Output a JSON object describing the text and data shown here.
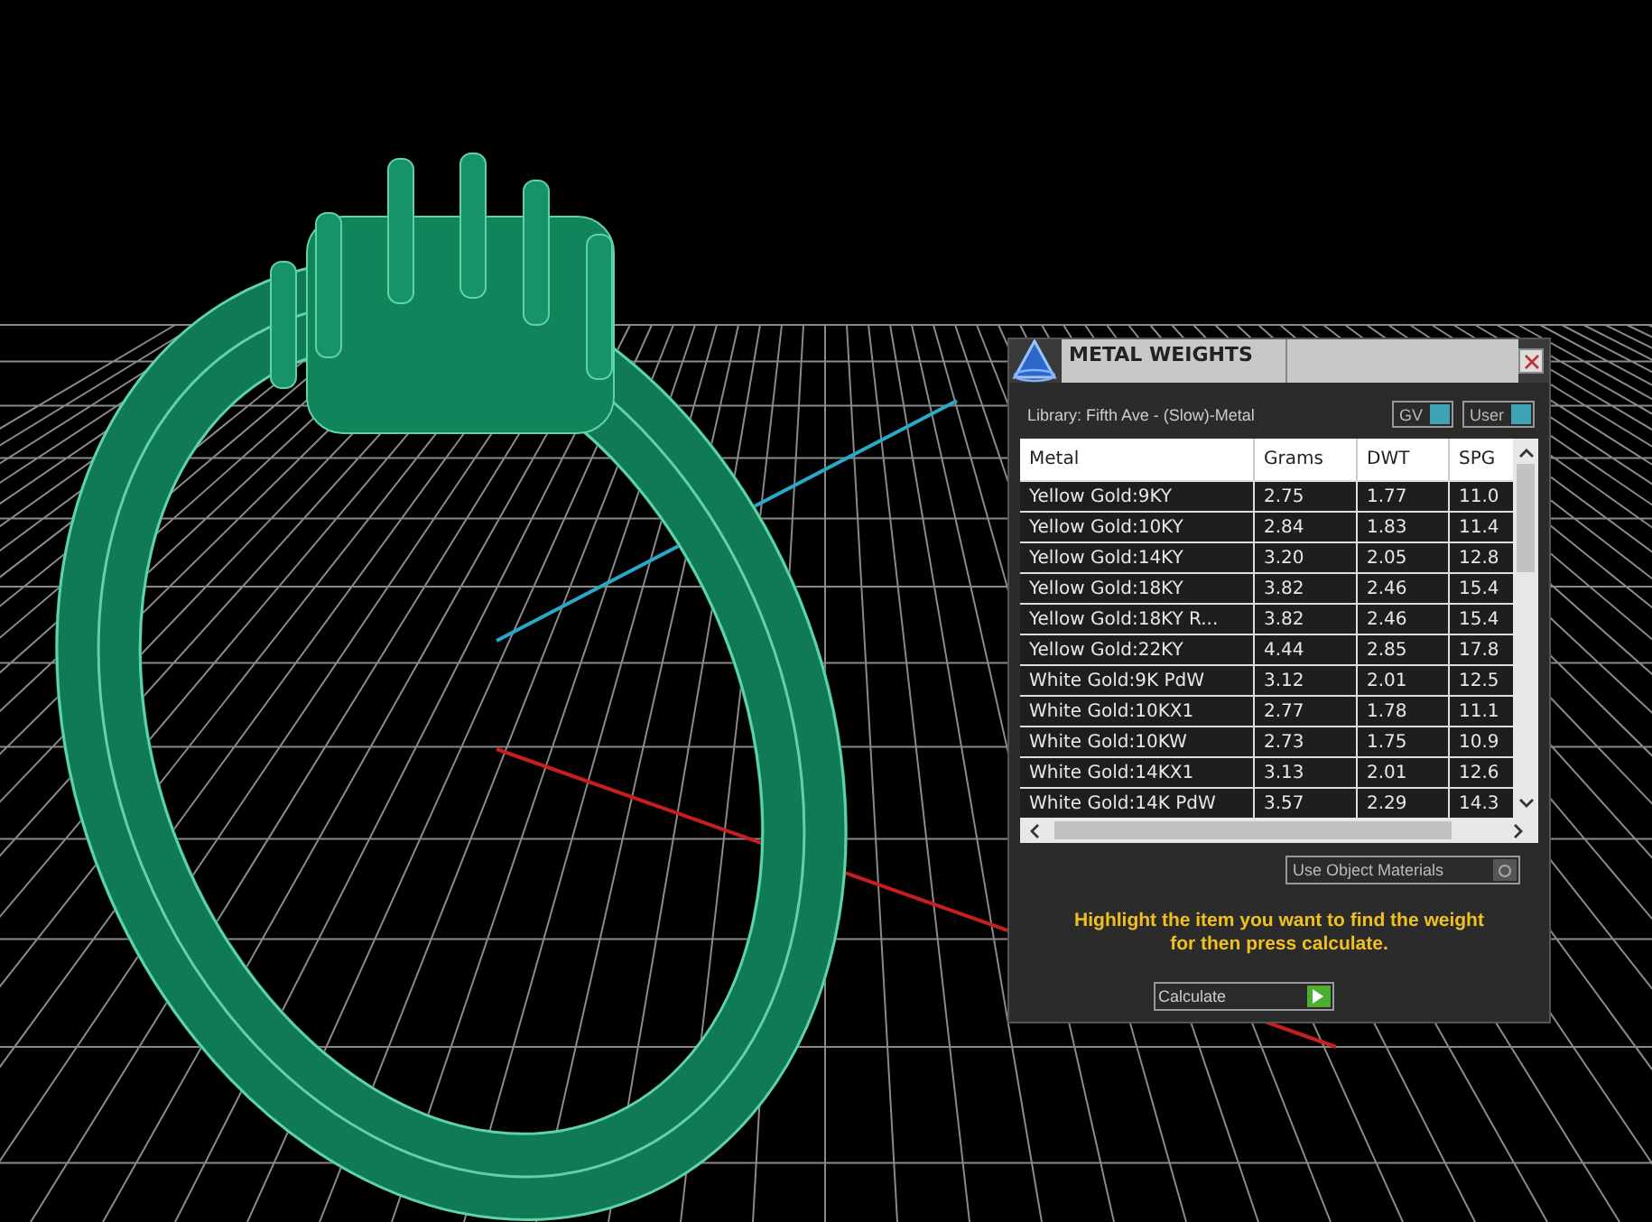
{
  "window": {
    "title": "METAL WEIGHTS"
  },
  "library": "Library: Fifth Ave - (Slow)-Metal",
  "toggles": [
    {
      "label": "GV",
      "on": true
    },
    {
      "label": "User",
      "on": true
    }
  ],
  "table": {
    "columns": [
      "Metal",
      "Grams",
      "DWT",
      "SPG"
    ],
    "rows": [
      [
        "Yellow Gold:9KY",
        "2.75",
        "1.77",
        "11.0"
      ],
      [
        "Yellow Gold:10KY",
        "2.84",
        "1.83",
        "11.4"
      ],
      [
        "Yellow Gold:14KY",
        "3.20",
        "2.05",
        "12.8"
      ],
      [
        "Yellow Gold:18KY",
        "3.82",
        "2.46",
        "15.4"
      ],
      [
        "Yellow Gold:18KY R...",
        "3.82",
        "2.46",
        "15.4"
      ],
      [
        "Yellow Gold:22KY",
        "4.44",
        "2.85",
        "17.8"
      ],
      [
        "White Gold:9K PdW",
        "3.12",
        "2.01",
        "12.5"
      ],
      [
        "White Gold:10KX1",
        "2.77",
        "1.78",
        "11.1"
      ],
      [
        "White Gold:10KW",
        "2.73",
        "1.75",
        "10.9"
      ],
      [
        "White Gold:14KX1",
        "3.13",
        "2.01",
        "12.6"
      ],
      [
        "White Gold:14K PdW",
        "3.57",
        "2.29",
        "14.3"
      ]
    ]
  },
  "use_object_materials": {
    "label": "Use Object Materials",
    "on": false
  },
  "message": "Highlight the item you want to find the weight for then press calculate.",
  "button": "Calculate"
}
